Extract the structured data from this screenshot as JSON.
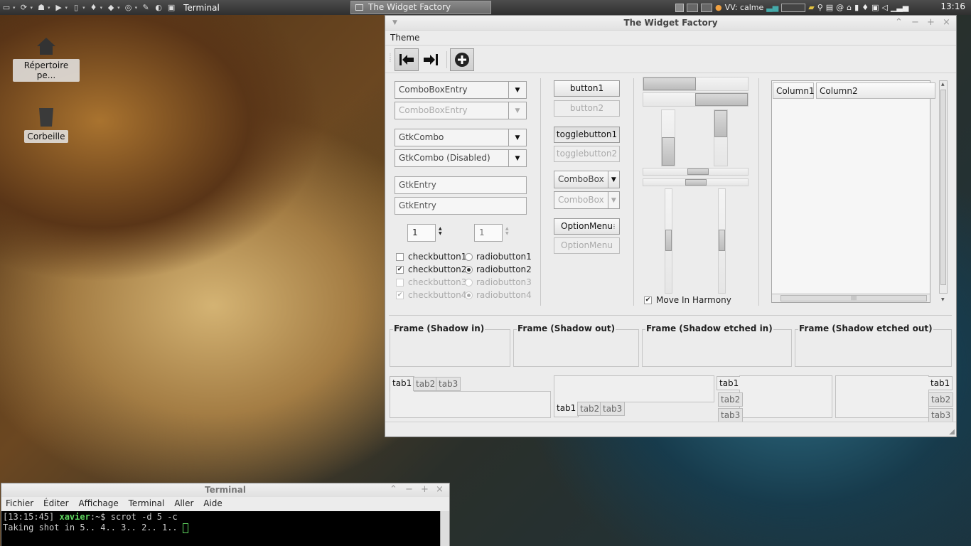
{
  "panel": {
    "active_title": "Terminal",
    "task_button": "The Widget Factory",
    "weather": "VV: calme",
    "clock": "13:16"
  },
  "desktop": {
    "home": "Répertoire pe...",
    "trash": "Corbeille"
  },
  "widget_factory": {
    "title": "The Widget Factory",
    "menu": {
      "theme": "Theme"
    },
    "combos": [
      "ComboBoxEntry",
      "ComboBoxEntry",
      "GtkCombo",
      "GtkCombo (Disabled)"
    ],
    "entries": [
      "GtkEntry",
      "GtkEntry"
    ],
    "spins": [
      "1",
      "1"
    ],
    "checks": [
      "checkbutton1",
      "checkbutton2",
      "checkbutton3",
      "checkbutton4"
    ],
    "radios": [
      "radiobutton1",
      "radiobutton2",
      "radiobutton3",
      "radiobutton4"
    ],
    "buttons": {
      "b1": "button1",
      "b2": "button2",
      "t1": "togglebutton1",
      "t2": "togglebutton2",
      "c1": "ComboBox",
      "c2": "ComboBox",
      "o1": "OptionMenu",
      "o2": "OptionMenu"
    },
    "harmony": "Move In Harmony",
    "columns": [
      "Column1",
      "Column2"
    ],
    "frames": [
      "Frame (Shadow in)",
      "Frame (Shadow out)",
      "Frame (Shadow etched in)",
      "Frame (Shadow etched out)"
    ],
    "tabs": [
      "tab1",
      "tab2",
      "tab3"
    ]
  },
  "terminal": {
    "title": "Terminal",
    "menu": [
      "Fichier",
      "Éditer",
      "Affichage",
      "Terminal",
      "Aller",
      "Aide"
    ],
    "prompt_time": "[13:15:45]",
    "prompt_user": "xavier",
    "prompt_rest": ":~$ scrot -d 5 -c",
    "line2": "Taking shot in 5.. 4.. 3.. 2.. 1.. "
  }
}
